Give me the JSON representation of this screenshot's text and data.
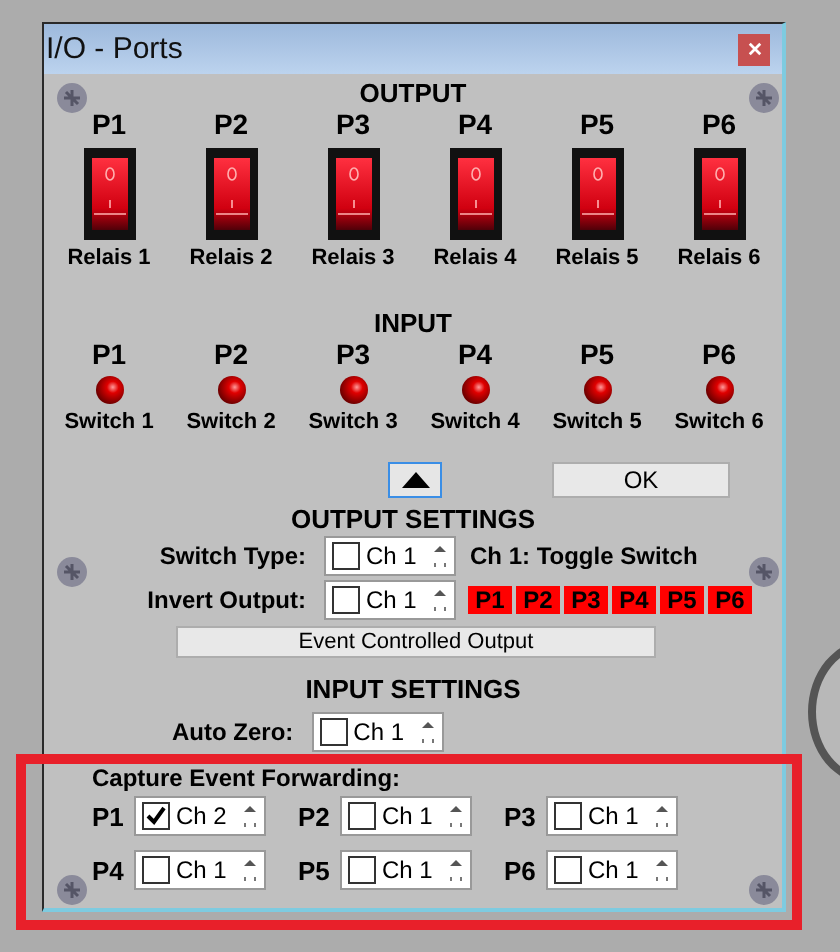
{
  "window": {
    "title": "I/O - Ports"
  },
  "output": {
    "heading": "OUTPUT",
    "ports": [
      {
        "label": "P1",
        "relay": "Relais 1",
        "on": true
      },
      {
        "label": "P2",
        "relay": "Relais 2",
        "on": true
      },
      {
        "label": "P3",
        "relay": "Relais 3",
        "on": true
      },
      {
        "label": "P4",
        "relay": "Relais 4",
        "on": true
      },
      {
        "label": "P5",
        "relay": "Relais 5",
        "on": true
      },
      {
        "label": "P6",
        "relay": "Relais 6",
        "on": true
      }
    ]
  },
  "input": {
    "heading": "INPUT",
    "ports": [
      {
        "label": "P1",
        "switch": "Switch 1"
      },
      {
        "label": "P2",
        "switch": "Switch 2"
      },
      {
        "label": "P3",
        "switch": "Switch 3"
      },
      {
        "label": "P4",
        "switch": "Switch 4"
      },
      {
        "label": "P5",
        "switch": "Switch 5"
      },
      {
        "label": "P6",
        "switch": "Switch 6"
      }
    ]
  },
  "ok_button": "OK",
  "output_settings": {
    "heading": "OUTPUT SETTINGS",
    "switch_type": {
      "label": "Switch Type:",
      "checked": false,
      "value": "Ch 1",
      "description": "Ch 1: Toggle Switch"
    },
    "invert_output": {
      "label": "Invert Output:",
      "checked": false,
      "value": "Ch 1",
      "ports": [
        "P1",
        "P2",
        "P3",
        "P4",
        "P5",
        "P6"
      ]
    },
    "event_button": "Event Controlled Output"
  },
  "input_settings": {
    "heading": "INPUT SETTINGS",
    "auto_zero": {
      "label": "Auto Zero:",
      "checked": false,
      "value": "Ch 1"
    }
  },
  "capture_event_forwarding": {
    "title": "Capture Event Forwarding:",
    "ports": [
      {
        "label": "P1",
        "checked": true,
        "value": "Ch 2"
      },
      {
        "label": "P2",
        "checked": false,
        "value": "Ch 1"
      },
      {
        "label": "P3",
        "checked": false,
        "value": "Ch 1"
      },
      {
        "label": "P4",
        "checked": false,
        "value": "Ch 1"
      },
      {
        "label": "P5",
        "checked": false,
        "value": "Ch 1"
      },
      {
        "label": "P6",
        "checked": false,
        "value": "Ch 1"
      }
    ]
  }
}
